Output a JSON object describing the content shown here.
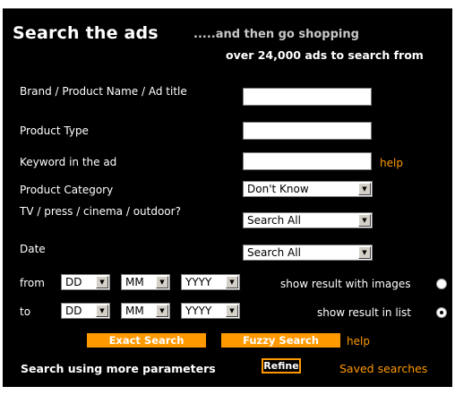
{
  "header": {
    "title": "Search the ads",
    "subtitle": ".....and then go shopping",
    "count_text": "over 24,000 ads to search from"
  },
  "fields": {
    "brand_label": "Brand / Product Name / Ad title",
    "brand_value": "",
    "product_type_label": "Product Type",
    "product_type_value": "",
    "keyword_label": "Keyword in the ad",
    "keyword_value": "",
    "keyword_help": "help",
    "category_label": "Product Category",
    "category_selected": "Don't Know",
    "media_label": "TV / press / cinema / outdoor?",
    "media_selected": "Search All",
    "date_label": "Date",
    "date_selected": "Search All"
  },
  "date_range": {
    "from_label": "from",
    "to_label": "to",
    "day": "DD",
    "month": "MM",
    "year": "YYYY"
  },
  "result_options": {
    "images_label": "show result with images",
    "list_label": "show result in list",
    "selected": "list"
  },
  "actions": {
    "exact_search": "Exact Search",
    "fuzzy_search": "Fuzzy Search",
    "search_help": "help",
    "more_params": "Search using more parameters",
    "refine": "Refine",
    "saved_searches": "Saved searches"
  },
  "colors": {
    "background": "#000000",
    "accent": "#ff9900",
    "text": "#ffffff"
  }
}
